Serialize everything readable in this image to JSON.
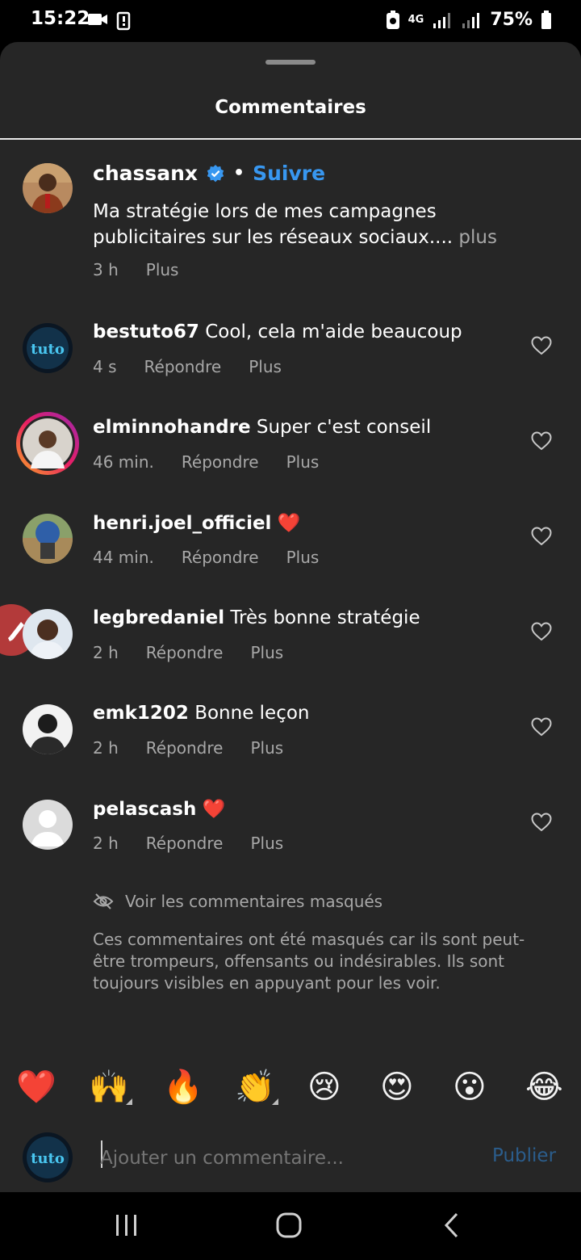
{
  "status": {
    "time": "15:22",
    "network": "4G",
    "battery": "75%"
  },
  "sheet": {
    "title": "Commentaires"
  },
  "caption": {
    "username": "chassanx",
    "follow": "Suivre",
    "text": "Ma stratégie lors de mes campagnes publicitaires sur les réseaux sociaux....",
    "more_inline": "plus",
    "time": "3 h",
    "more": "Plus"
  },
  "comments": [
    {
      "username": "bestuto67",
      "text": "Cool, cela m'aide beaucoup",
      "time": "4 s",
      "reply": "Répondre",
      "more": "Plus"
    },
    {
      "username": "elminnohandre",
      "text": "Super c'est conseil",
      "time": "46 min.",
      "reply": "Répondre",
      "more": "Plus"
    },
    {
      "username": "henri.joel_officiel",
      "text": "❤️",
      "time": "44 min.",
      "reply": "Répondre",
      "more": "Plus"
    },
    {
      "username": "legbredaniel",
      "text": "Très bonne stratégie",
      "time": "2 h",
      "reply": "Répondre",
      "more": "Plus"
    },
    {
      "username": "emk1202",
      "text": "Bonne leçon",
      "time": "2 h",
      "reply": "Répondre",
      "more": "Plus"
    },
    {
      "username": "pelascash",
      "text": "❤️",
      "time": "2 h",
      "reply": "Répondre",
      "more": "Plus"
    }
  ],
  "hidden": {
    "link": "Voir les commentaires masqués",
    "note": "Ces commentaires ont été masqués car ils sont peut-être trompeurs, offensants ou indésirables. Ils sont toujours visibles en appuyant pour les voir."
  },
  "emojis": [
    "❤️",
    "🙌",
    "🔥",
    "👏",
    "😢",
    "😍",
    "😮",
    "😂"
  ],
  "composer": {
    "placeholder": "Ajouter un commentaire...",
    "publish": "Publier"
  },
  "colors": {
    "sheet_bg": "#262626",
    "accent": "#3897f0",
    "muted": "#a8a8a8",
    "publish_disabled": "#2b5d8c"
  }
}
